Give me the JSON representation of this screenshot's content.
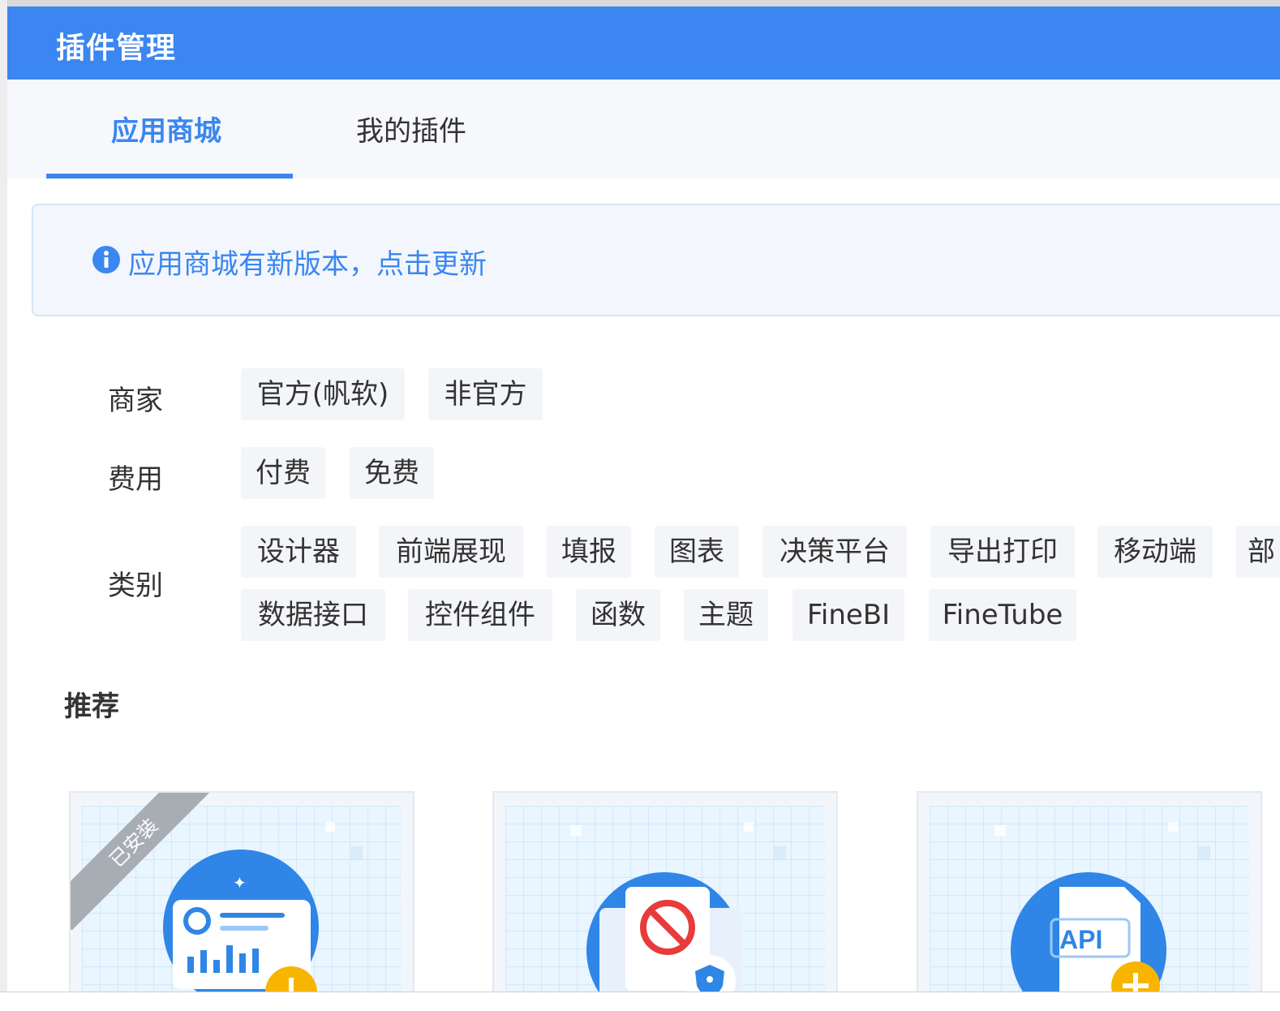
{
  "dialog": {
    "title": "插件管理"
  },
  "tabs": [
    {
      "label": "应用商城",
      "active": true
    },
    {
      "label": "我的插件",
      "active": false
    }
  ],
  "notice": {
    "text": "应用商城有新版本，点击更新"
  },
  "filters": {
    "vendor": {
      "label": "商家",
      "options": [
        "官方(帆软)",
        "非官方"
      ]
    },
    "fee": {
      "label": "费用",
      "options": [
        "付费",
        "免费"
      ]
    },
    "category": {
      "label": "类别",
      "row1": [
        "设计器",
        "前端展现",
        "填报",
        "图表",
        "决策平台",
        "导出打印",
        "移动端",
        "部"
      ],
      "row2": [
        "数据接口",
        "控件组件",
        "函数",
        "主题",
        "FineBI",
        "FineTube"
      ]
    }
  },
  "recommend": {
    "title": "推荐",
    "cards": [
      {
        "badge": "已安装",
        "icon": "dashboard-chart-icon"
      },
      {
        "badge": "",
        "icon": "forbidden-shield-icon"
      },
      {
        "badge": "",
        "icon": "api-add-icon"
      }
    ]
  },
  "colors": {
    "primary": "#3b86f0",
    "chip_bg": "#f3f5f8",
    "notice_bg": "#f3f7fd"
  }
}
